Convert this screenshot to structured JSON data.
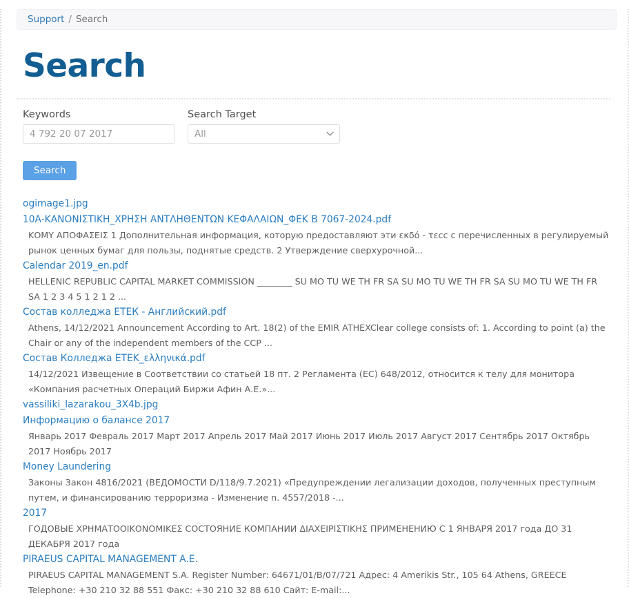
{
  "breadcrumb": {
    "parent_label": "Support",
    "separator": "/",
    "current_label": "Search"
  },
  "page": {
    "title": "Search"
  },
  "form": {
    "keywords_label": "Keywords",
    "keywords_value": "4 792 20 07 2017",
    "keywords_placeholder": "4 792 20 07 2017",
    "target_label": "Search Target",
    "target_selected": "All",
    "target_options": [
      "All"
    ],
    "submit_label": "Search",
    "chevron_icon": "chevron-down-icon",
    "accent_color": "#5ba1e6",
    "link_color": "#2b7ec1",
    "title_color": "#125d91"
  },
  "results": [
    {
      "title": "ogimage1.jpg",
      "snippet": ""
    },
    {
      "title": "10A-ΚΑΝΟΝΙΣΤΙΚΗ_ΧΡΗΣΗ ΑΝΤΛΗΘΕΝΤΩΝ ΚΕΦΑΛΑΙΩΝ_ΦΕΚ Β 7067-2024.pdf",
      "snippet": "ΚΟΜΥ ΑΠΟΦΑΣΕΙΣ 1 Дополнительная информация, которую предоставляют эти εκδό - τεсс с перечисленных в регулируемый рынок ценных бумаг для пользы, поднятые средств. 2 Утверждение сверхурочной..."
    },
    {
      "title": "Calendar 2019_en.pdf",
      "snippet": "HELLENIC REPUBLIC CAPITAL MARKET COMMISSION ________ SU MO TU WE TH FR SA SU MO TU WE TH FR SA SU MO TU WE TH FR SA 1 2 3 4 5 1 2 1 2 ..."
    },
    {
      "title": "Состав колледжа ЕТЕК - Английский.pdf",
      "snippet": "Athens, 14/12/2021 Announcement According to Art. 18(2) of the EMIR ATHEXClear college consists of: 1. According to point (a) the Chair or any of the independent members of the CCP ..."
    },
    {
      "title": "Состав Колледжа ΕΤΕΚ_ελληνικά.pdf",
      "snippet": "14/12/2021 Извещение в Соответствии со статьей 18 пт. 2 Регламента (ЕС) 648/2012, относится к телу для монитора «Компания расчетных Операций Биржи Афин А.Е.»..."
    },
    {
      "title": "vassiliki_lazarakou_3X4b.jpg",
      "snippet": ""
    },
    {
      "title": "Информацию о балансе 2017",
      "snippet": "Январь 2017 Февраль 2017 Март 2017 Апрель 2017 Май 2017 Июнь 2017 Июль 2017 Август 2017 Сентябрь 2017 Октябрь 2017 Ноябрь 2017"
    },
    {
      "title": "Money Laundering",
      "snippet": "Законы Закон 4816/2021 (ВЕДОМОСТИ D/118/9.7.2021) «Предупреждении легализации доходов, полученных преступным путем, и финансированию терроризма - Изменение n. 4557/2018 -..."
    },
    {
      "title": "2017",
      "snippet": "ГОДОВЫЕ ΧΡΗΜΑΤΟΟΙΚΟΝΟΜΙΚΕΣ СОСТОЯНИЕ КОМПАНИИ ΔΙΑΧΕΙΡΙΣΤΙΚΗΣ ПРИМЕНЕНИЮ С 1 ЯНВАРЯ 2017 года ДО 31 ДЕКАБРЯ 2017 года"
    },
    {
      "title": "PIRAEUS CAPITAL MANAGEMENT A.E.",
      "snippet": "PIRAEUS CAPITAL MANAGEMENT S.A. Register Number: 64671/01/B/07/721 Адрес: 4 Amerikis Str., 105 64 Athens, GREECE Telephone: +30 210 32 88 551 Факс: +30 210 32 88 610 Сайт: E-mail:..."
    }
  ]
}
